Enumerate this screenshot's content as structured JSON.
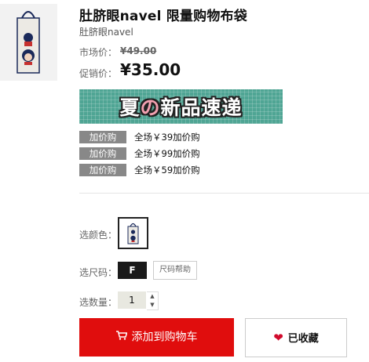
{
  "product": {
    "title": "肚脐眼navel 限量购物布袋",
    "brand": "肚脐眼navel",
    "thumbnail_icon": "tote-bag-image"
  },
  "pricing": {
    "market_label": "市场价：",
    "market_price": "¥49.00",
    "promo_label": "促销价：",
    "promo_price": "¥35.00"
  },
  "banner": {
    "text_before": "夏",
    "text_highlight": "の",
    "text_after": "新品速递"
  },
  "promotions": [
    {
      "tag": "加价购",
      "desc": "全场￥39加价购"
    },
    {
      "tag": "加价购",
      "desc": "全场￥99加价购"
    },
    {
      "tag": "加价购",
      "desc": "全场￥59加价购"
    }
  ],
  "options": {
    "color_label": "选颜色：",
    "size_label": "选尺码：",
    "size_value": "F",
    "size_help": "尺码帮助",
    "qty_label": "选数量：",
    "qty_value": "1"
  },
  "actions": {
    "cart_label": "添加到购物车",
    "cart_icon": "shopping-cart-icon",
    "fav_label": "已收藏",
    "fav_icon": "heart-icon"
  },
  "colors": {
    "cart_bg": "#e00d0d",
    "banner_bg": "#4fa594",
    "tag_bg": "#888888",
    "heart": "#d10a2c"
  }
}
